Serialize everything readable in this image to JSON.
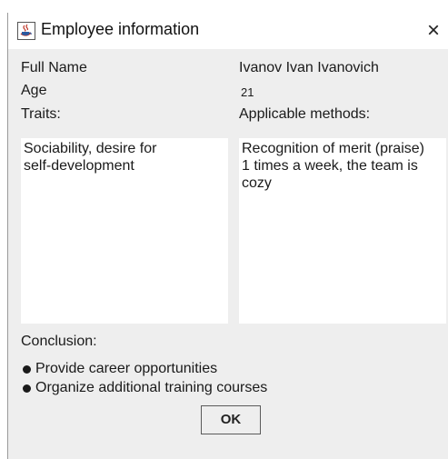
{
  "window": {
    "title": "Employee information",
    "title_icon": "java-cup-icon",
    "close_glyph": "×"
  },
  "fields": {
    "full_name_label": "Full Name",
    "full_name_value": "Ivanov Ivan Ivanovich",
    "age_label": "Age",
    "age_value": "21",
    "traits_label": "Traits:",
    "traits_value": "Sociability, desire for\nself-development",
    "methods_label": "Applicable methods:",
    "methods_value": "Recognition of merit (praise)\n1 times a week, the team is\ncozy"
  },
  "conclusion": {
    "label": "Conclusion:",
    "items": [
      "Provide career opportunities",
      "Organize additional training courses"
    ]
  },
  "buttons": {
    "ok_label": "OK"
  },
  "colors": {
    "window_bg": "#eeeeee",
    "titlebar_bg": "#ffffff",
    "text": "#1a1a1a"
  }
}
